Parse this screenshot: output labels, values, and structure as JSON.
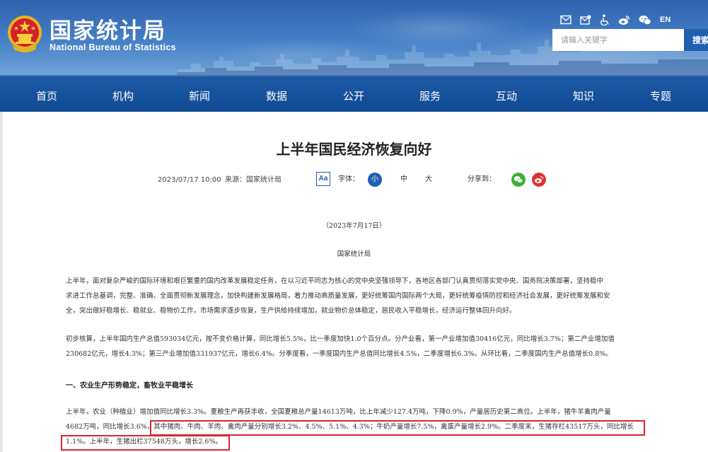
{
  "header": {
    "logo_cn": "国家统计局",
    "logo_en": "National Bureau of Statistics",
    "lang": "EN",
    "search_placeholder": "请输入关键字",
    "search_label": "搜索",
    "icons": [
      "mail-icon",
      "mail-alt-icon",
      "accessibility-icon",
      "weibo-icon",
      "wechat-icon"
    ]
  },
  "nav": [
    "首页",
    "机构",
    "新闻",
    "数据",
    "公开",
    "服务",
    "互动",
    "知识",
    "专题"
  ],
  "article": {
    "title": "上半年国民经济恢复向好",
    "date": "2023/07/17 10:00",
    "source": "来源：国家统计局",
    "aa": "Aa",
    "font_label": "字体：",
    "font_small": "小",
    "font_medium": "中",
    "font_large": "大",
    "share_label": "分享到：",
    "dateline": "（2023年7月17日）",
    "byline": "国家统计局",
    "p1_l1": "上半年，面对复杂严峻的国际环境和艰巨繁重的国内改革发展稳定任务，在以习近平同志为核心的党中央坚强领导下，各地区各部门认真贯彻落实党中央、国务院决策部署，坚持稳中",
    "p1_l2": "求进工作总基调，完整、准确、全面贯彻新发展理念，加快构建新发展格局，着力推动高质量发展，更好统筹国内国际两个大局，更好统筹疫情防控和经济社会发展，更好统筹发展和安",
    "p1_l3": "全，突出做好稳增长、稳就业、稳物价工作，市场需求逐步恢复，生产供给持续增加，就业物价总体稳定，居民收入平稳增长，经济运行整体回升向好。",
    "p2_l1": "初步核算，上半年国内生产总值593034亿元，按不变价格计算，同比增长5.5%，比一季度加快1.0个百分点。分产业看，第一产业增加值30416亿元，同比增长3.7%；第二产业增加值",
    "p2_l2": "230682亿元，增长4.3%；第三产业增加值331937亿元，增长6.4%。分季度看，一季度国内生产总值同比增长4.5%，二季度增长6.3%。从环比看，二季度国内生产总值增长0.8%。",
    "section1": "一、农业生产形势稳定，畜牧业平稳增长",
    "p3_l1": "上半年，农业（种植业）增加值同比增长3.3%。夏粮生产再获丰收，全国夏粮总产量14613万吨，比上年减少127.4万吨，下降0.9%，产量居历史第二高位。上半年，猪牛羊禽肉产量",
    "p3_l2": "4682万吨，同比增长3.6%，其中猪肉、牛肉、羊肉、禽肉产量分别增长3.2%、4.5%、5.1%、4.3%；牛奶产量增长7.5%，禽蛋产量增长2.9%。二季度末，生猪存栏43517万头，同比增长",
    "p3_l3": "1.1%。上半年，生猪出栏37548万头，增长2.6%。"
  },
  "colors": {
    "nav_blue": "#0f4a93",
    "highlight_red": "#d8262c",
    "accent_blue": "#1f5fae"
  }
}
